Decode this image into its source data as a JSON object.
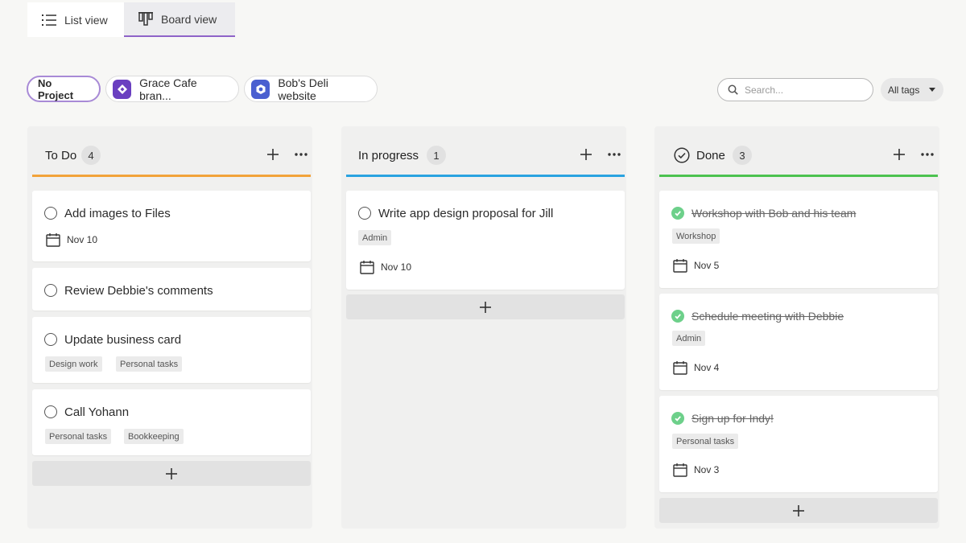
{
  "views": {
    "list_label": "List view",
    "board_label": "Board view"
  },
  "projects": {
    "items": [
      {
        "label": "No Project",
        "active": true
      },
      {
        "label": "Grace Cafe bran...",
        "icon": "diamond-icon",
        "icon_color": "#6a3fc0"
      },
      {
        "label": "Bob's Deli website",
        "icon": "hexagon-icon",
        "icon_color": "#4a5fd0"
      }
    ]
  },
  "search": {
    "placeholder": "Search..."
  },
  "tags_filter": {
    "label": "All tags"
  },
  "columns": [
    {
      "title": "To Do",
      "count": "4",
      "accent": "#f2a33a",
      "cards": [
        {
          "title": "Add images to Files",
          "tags": [],
          "date": "Nov 10",
          "done": false
        },
        {
          "title": "Review Debbie's comments",
          "tags": [],
          "date": "",
          "done": false
        },
        {
          "title": "Update business card",
          "tags": [
            "Design work",
            "Personal tasks"
          ],
          "date": "",
          "done": false
        },
        {
          "title": "Call Yohann",
          "tags": [
            "Personal tasks",
            "Bookkeeping"
          ],
          "date": "",
          "done": false
        }
      ]
    },
    {
      "title": "In progress",
      "count": "1",
      "accent": "#2aa3e0",
      "cards": [
        {
          "title": "Write app design proposal for Jill",
          "tags": [
            "Admin"
          ],
          "date": "Nov 10",
          "done": false
        }
      ]
    },
    {
      "title": "Done",
      "count": "3",
      "accent": "#4cc24f",
      "cards": [
        {
          "title": "Workshop with Bob and his team",
          "tags": [
            "Workshop"
          ],
          "date": "Nov 5",
          "done": true
        },
        {
          "title": "Schedule meeting with Debbie",
          "tags": [
            "Admin"
          ],
          "date": "Nov 4",
          "done": true
        },
        {
          "title": "Sign up for Indy!",
          "tags": [
            "Personal tasks"
          ],
          "date": "Nov 3",
          "done": true
        }
      ]
    }
  ]
}
